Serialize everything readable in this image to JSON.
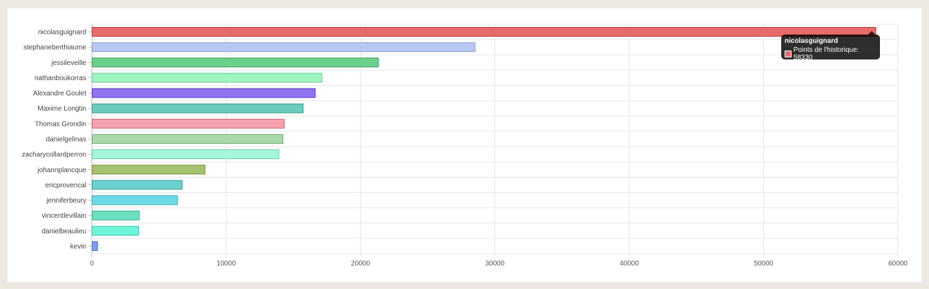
{
  "chart_data": {
    "type": "bar",
    "orientation": "horizontal",
    "categories": [
      "nicolasguignard",
      "stephaneberthiaume",
      "jessileveille",
      "nathanboukorras",
      "Alexandre Goulet",
      "Maxime Longtin",
      "Thomas Grondin",
      "danielgelinas",
      "zacharycollardperron",
      "johannplancque",
      "ericprovencal",
      "jenniferbeury",
      "vincentlevillain",
      "danielbeaulieu",
      "kevin"
    ],
    "series": [
      {
        "name": "Points de l'historique",
        "values": [
          58330,
          28500,
          21300,
          17100,
          16600,
          15700,
          14300,
          14200,
          13900,
          8400,
          6700,
          6350,
          3500,
          3450,
          400
        ]
      }
    ],
    "colors": [
      "#e86b6b",
      "#b8c8f2",
      "#6ad08a",
      "#9ff5c0",
      "#8e72ef",
      "#6ccbbd",
      "#f4a0ae",
      "#a9d9aa",
      "#a4f7dd",
      "#a7c26e",
      "#6bd0d0",
      "#6ddbe5",
      "#6de0bf",
      "#6ef5d8",
      "#7a9ff0"
    ],
    "border_colors": [
      "#b83838",
      "#8aa0d8",
      "#3a9a58",
      "#70c890",
      "#5a3ec0",
      "#3a9a8c",
      "#d06a7c",
      "#78aa7a",
      "#70c8ac",
      "#789040",
      "#3aa0a0",
      "#3aa8b4",
      "#3aae8e",
      "#3ec4a8",
      "#4a70c8"
    ],
    "x_ticks": [
      "0",
      "10000",
      "20000",
      "30000",
      "40000",
      "50000",
      "60000"
    ],
    "xlim": [
      0,
      60000
    ],
    "grid": true,
    "legend": "none"
  },
  "tooltip": {
    "title": "nicolasguignard",
    "label": "Points de l'historique: 58330",
    "swatch_color": "#e86b6b"
  }
}
